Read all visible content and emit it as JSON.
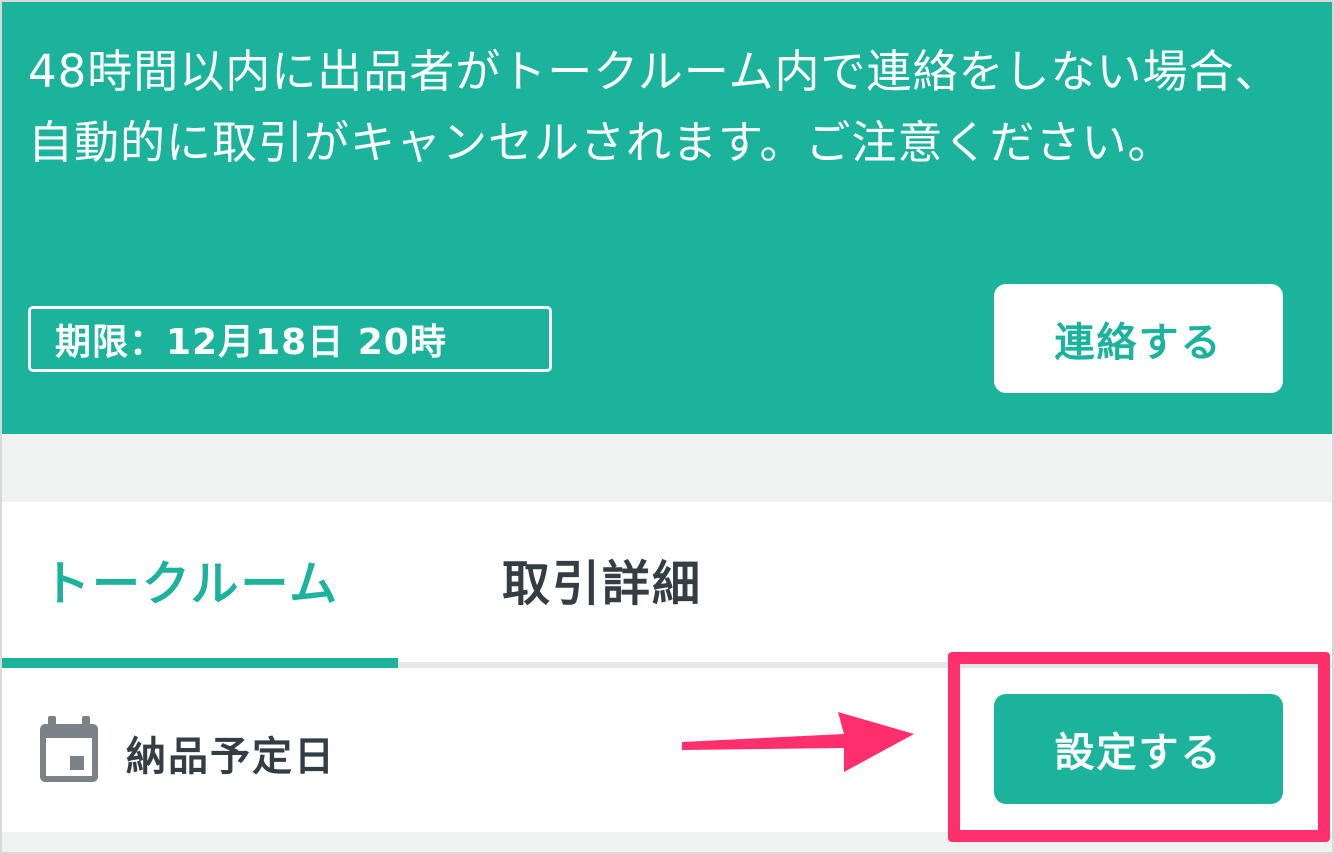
{
  "banner": {
    "message": "48時間以内に出品者がトークルーム内で連絡をしない場合、自動的に取引がキャンセルされます。ご注意ください。",
    "deadline": "期限：12月18日 20時",
    "contact_button": "連絡する"
  },
  "tabs": [
    {
      "label": "トークルーム",
      "active": true
    },
    {
      "label": "取引詳細",
      "active": false
    }
  ],
  "delivery": {
    "icon": "calendar-icon",
    "label": "納品予定日",
    "set_button": "設定する"
  },
  "colors": {
    "accent": "#1bb39b",
    "highlight": "#ff2e6c",
    "text_dark": "#333d44"
  }
}
